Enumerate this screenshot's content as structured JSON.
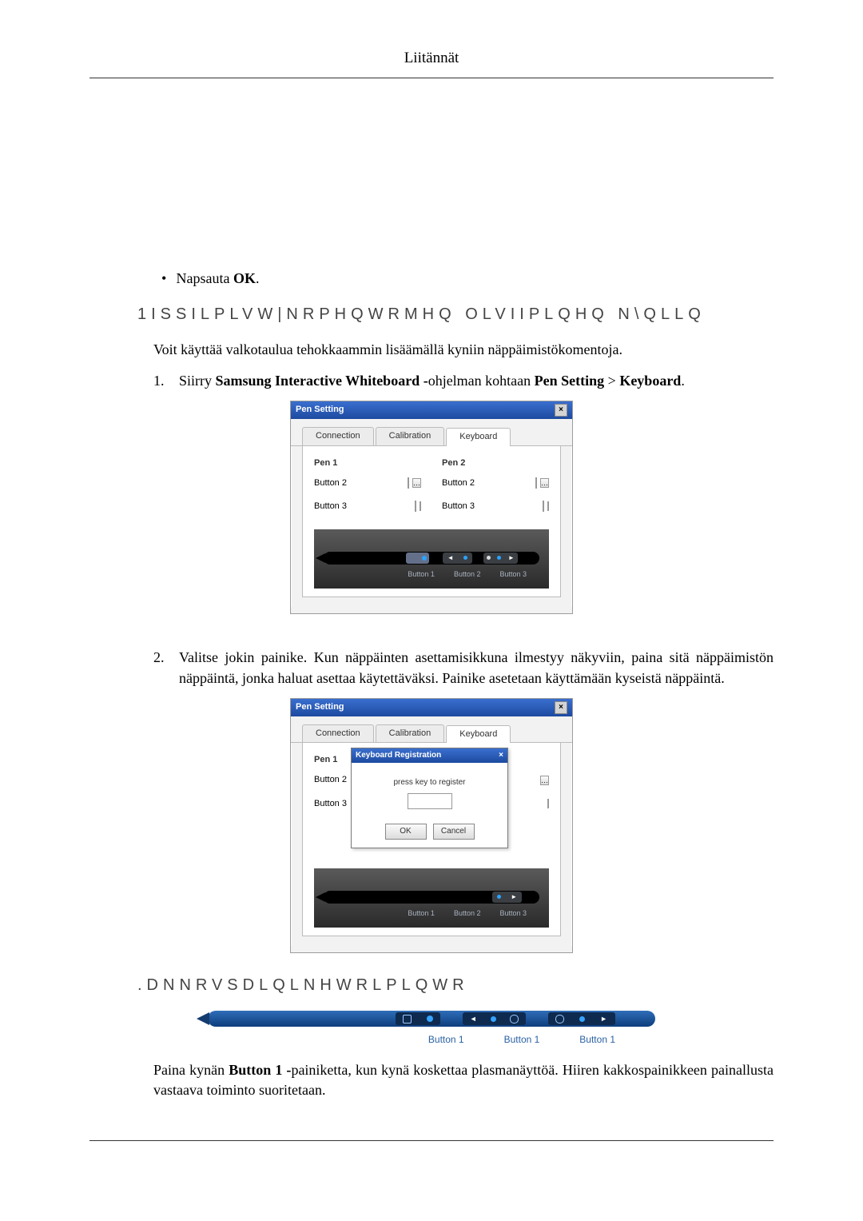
{
  "page_header": "Liitännät",
  "bullet1_pre": "Napsauta ",
  "bullet1_b": "OK",
  "bullet1_post": ".",
  "heading1": "1ISSILPLVW|NRPHQWRMHQ OLVIIPLQHQ N\\QLLQ",
  "intro": "Voit käyttää valkotaulua tehokkaammin lisäämällä kyniin näppäimistökomentoja.",
  "step1_num": "1.",
  "step1_pre": "Siirry ",
  "step1_b1": "Samsung Interactive Whiteboard -",
  "step1_mid": "ohjelman kohtaan ",
  "step1_b2": "Pen Setting",
  "step1_gt": " > ",
  "step1_b3": "Keyboard",
  "step1_post": ".",
  "dlg": {
    "title": "Pen Setting",
    "tabs": {
      "connection": "Connection",
      "calibration": "Calibration",
      "keyboard": "Keyboard"
    },
    "pen1": "Pen 1",
    "pen2": "Pen 2",
    "button2": "Button 2",
    "button3": "Button 3",
    "lbl_b1": "Button 1",
    "lbl_b2": "Button 2",
    "lbl_b3": "Button 3"
  },
  "step2_num": "2.",
  "step2_txt": "Valitse jokin painike. Kun näppäinten asettamisikkuna ilmestyy näkyviin, paina sitä näppäimistön näppäintä, jonka haluat asettaa käytettäväksi. Painike asetetaan käyttämään kyseistä näppäintä.",
  "modal": {
    "title": "Keyboard Registration",
    "prompt": "press key to register",
    "ok": "OK",
    "cancel": "Cancel"
  },
  "heading2": ".DNNRVSDLQLNHWRLPLQWR",
  "bigpen": {
    "b1": "Button 1",
    "b2": "Button 1",
    "b3": "Button 1"
  },
  "para_pre": "Paina kynän ",
  "para_b": "Button 1 -",
  "para_mid": "painiketta, kun kynä koskettaa plasmanäyttöä. Hiiren kakkospainikkeen painallusta vastaava toiminto suoritetaan."
}
